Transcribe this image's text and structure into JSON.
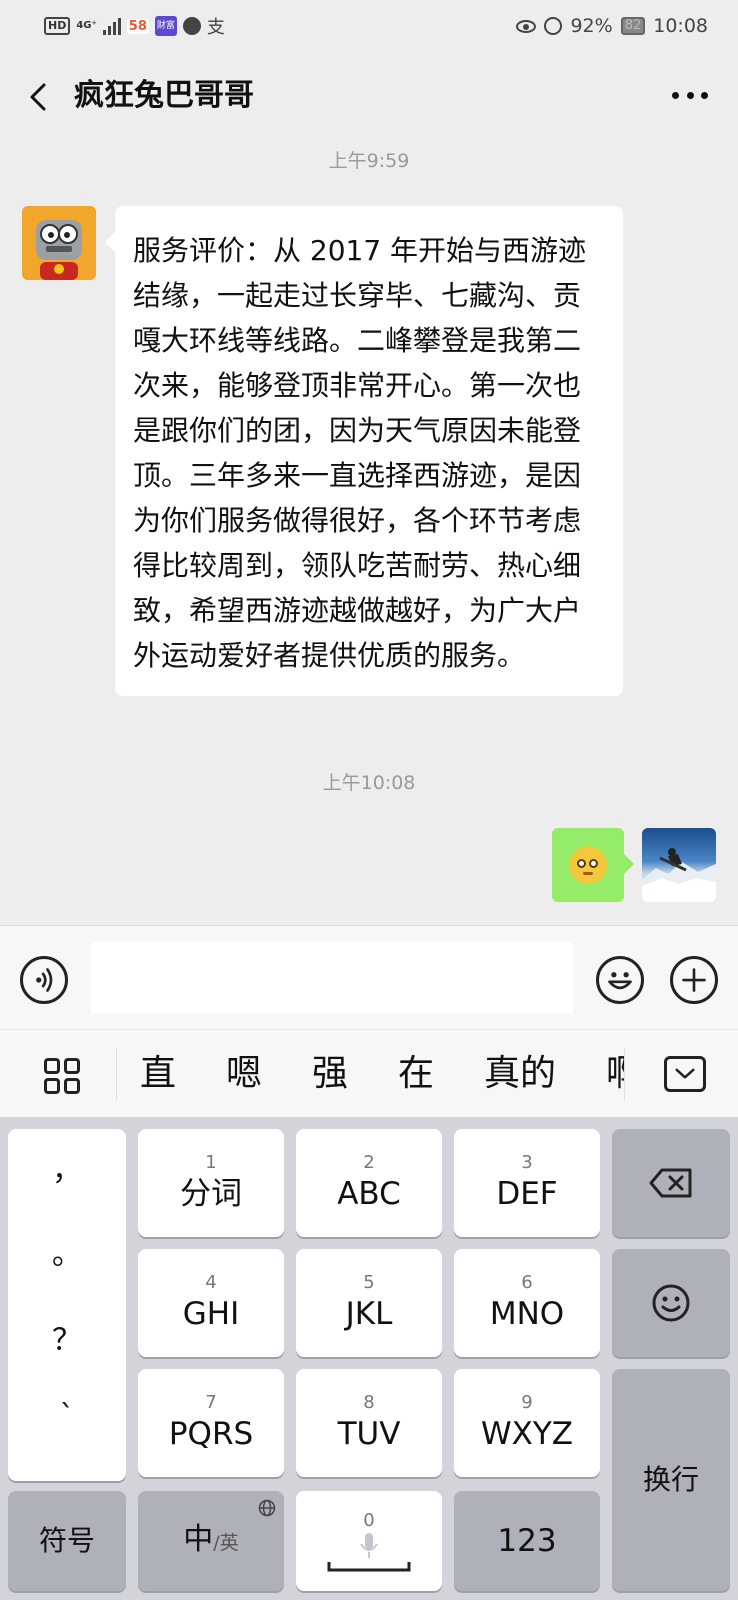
{
  "status_bar": {
    "hd": "HD",
    "network": "4G⁺",
    "app_58": "58",
    "app_finance": "财富",
    "pay_icon": "支",
    "battery_pct": "92%",
    "battery_level": "82",
    "time": "10:08"
  },
  "header": {
    "title": "疯狂兔巴哥哥"
  },
  "chat": {
    "messages": [
      {
        "time": "上午9:59",
        "sender": "contact",
        "text": "服务评价：从 2017 年开始与西游迹结缘，一起走过长穿毕、七藏沟、贡嘎大环线等线路。二峰攀登是我第二次来，能够登顶非常开心。第一次也是跟你们的团，因为天气原因未能登顶。三年多来一直选择西游迹，是因为你们服务做得很好，各个环节考虑得比较周到，领队吃苦耐劳、热心细致，希望西游迹越做越好，为广大户外运动爱好者提供优质的服务。"
      },
      {
        "time": "上午10:08",
        "sender": "me",
        "sticker": "thinking-face-emoji"
      }
    ]
  },
  "input_bar": {
    "value": "",
    "icons": [
      "voice-icon",
      "emoji-icon",
      "plus-icon"
    ]
  },
  "candidates": [
    "直",
    "嗯",
    "强",
    "在",
    "真的",
    "啊"
  ],
  "keyboard": {
    "punctuation": [
      "，",
      "。",
      "？",
      "`"
    ],
    "keys": [
      {
        "num": "1",
        "label": "分词"
      },
      {
        "num": "2",
        "label": "ABC"
      },
      {
        "num": "3",
        "label": "DEF"
      },
      {
        "num": "4",
        "label": "GHI"
      },
      {
        "num": "5",
        "label": "JKL"
      },
      {
        "num": "6",
        "label": "MNO"
      },
      {
        "num": "7",
        "label": "PQRS"
      },
      {
        "num": "8",
        "label": "TUV"
      },
      {
        "num": "9",
        "label": "WXYZ"
      }
    ],
    "symbols": "符号",
    "lang_main": "中",
    "lang_sub": "/英",
    "space_num": "0",
    "numbers": "123",
    "enter": "换行"
  },
  "colors": {
    "background": "#ededed",
    "my_bubble": "#95ec69",
    "their_bubble": "#ffffff",
    "keyboard_bg": "#d2d4da"
  }
}
